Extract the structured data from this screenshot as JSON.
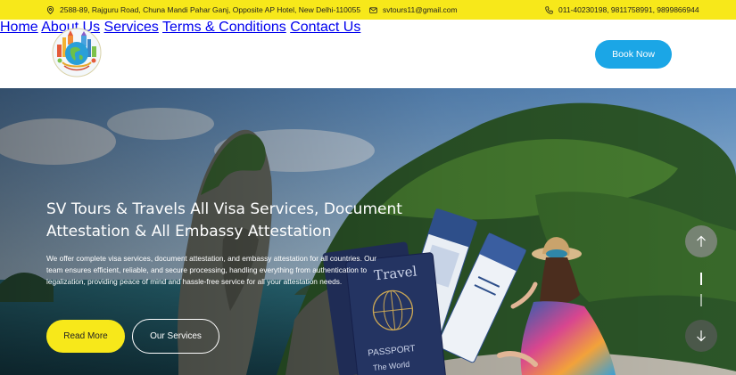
{
  "topbar": {
    "address": "2588-89, Rajguru Road, Chuna Mandi Pahar Ganj, Opposite AP Hotel, New Delhi-110055",
    "email": "svtours11@gmail.com",
    "phones": "011-40230198, 9811758991, 9899866944",
    "background": "#f7e81a"
  },
  "nav": {
    "items": [
      "Home",
      "About Us",
      "Services",
      "Terms & Conditions",
      "Contact Us"
    ],
    "cta": "Book Now",
    "cta_color": "#1ba6e6"
  },
  "hero": {
    "title_line1": "SV Tours & Travels All Visa Services, Document",
    "title_line2": "Attestation & All Embassy Attestation",
    "text_line1": "We offer complete visa services, document attestation, and embassy attestation for all countries. Our",
    "text_line2": "team ensures efficient, reliable, and secure processing, handling everything from authentication to",
    "text_line3": "legalization, providing peace of mind and hassle-free service for all your attestation needs.",
    "primary_button": "Read More",
    "secondary_button": "Our Services",
    "passport_label1": "Travel",
    "passport_label2": "PASSPORT",
    "passport_label3": "The World",
    "icons": [
      "arrow-up-icon",
      "arrow-down-icon"
    ]
  }
}
